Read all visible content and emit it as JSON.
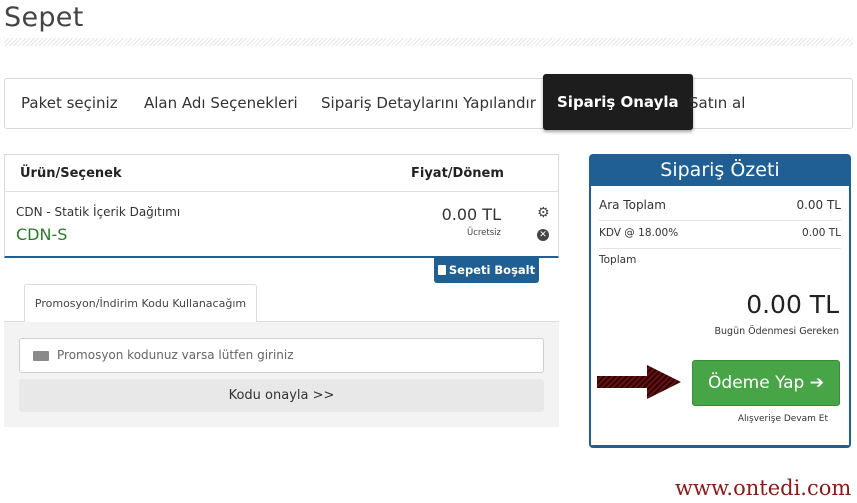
{
  "page": {
    "title": "Sepet"
  },
  "steps": [
    {
      "label": "Paket seçiniz"
    },
    {
      "label": "Alan Adı Seçenekleri"
    },
    {
      "label": "Sipariş Detaylarını Yapılandır"
    },
    {
      "label": "Sipariş Onayla",
      "active": true
    },
    {
      "label": "Satın al"
    }
  ],
  "cart": {
    "header_product": "Ürün/Seçenek",
    "header_price": "Fiyat/Dönem",
    "item": {
      "name": "CDN - Statik İçerik Dağıtımı",
      "option": "CDN-S",
      "price": "0.00 TL",
      "price_note": "Ücretsiz",
      "settings_icon": "gear-icon",
      "remove_icon": "close-circle-icon"
    },
    "empty_button": "Sepeti Boşalt"
  },
  "promo": {
    "tab_label": "Promosyon/İndirim Kodu Kullanacağım",
    "placeholder": "Promosyon kodunuz varsa lütfen giriniz",
    "apply_button": "Kodu onayla >>"
  },
  "summary": {
    "title": "Sipariş Özeti",
    "subtotal_label": "Ara Toplam",
    "subtotal_value": "0.00 TL",
    "tax_label": "KDV @ 18.00%",
    "tax_value": "0.00 TL",
    "total_label": "Toplam",
    "total_value": "0.00 TL",
    "due_today_label": "Bugün Ödenmesi Gereken",
    "checkout_button": "Ödeme Yap",
    "continue_link": "Alışverişe Devam Et"
  },
  "watermark": "www.ontedi.com",
  "colors": {
    "accent": "#1f5f94",
    "active_step": "#1d1d1d",
    "checkout": "#47a447",
    "option_text": "#2a7a2a",
    "watermark": "#8b1a1a"
  }
}
